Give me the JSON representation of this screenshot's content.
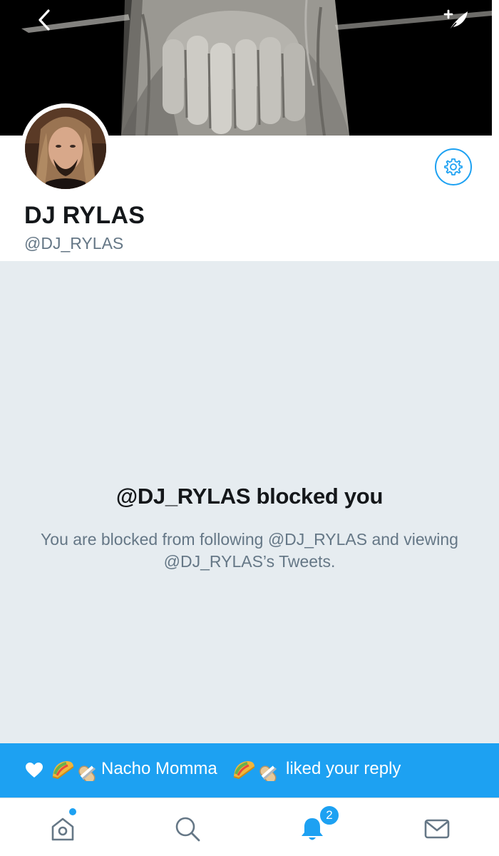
{
  "profile": {
    "display_name": "DJ RYLAS",
    "handle": "@DJ_RYLAS"
  },
  "blocked": {
    "title": "@DJ_RYLAS blocked you",
    "description": "You are blocked from following @DJ_RYLAS and viewing @DJ_RYLAS’s Tweets."
  },
  "toast": {
    "user_name": "Nacho Momma",
    "action_text": "liked your reply",
    "icon": "heart-icon",
    "emojis": [
      "taco",
      "burrito"
    ]
  },
  "tabbar": {
    "items": [
      {
        "icon": "home-icon",
        "has_dot": true
      },
      {
        "icon": "search-icon"
      },
      {
        "icon": "notifications-bell-icon",
        "active": true,
        "badge": "2"
      },
      {
        "icon": "messages-envelope-icon"
      }
    ]
  },
  "colors": {
    "accent": "#1da1f2",
    "blocked_bg": "#e6ecf0",
    "secondary_text": "#657786",
    "primary_text": "#14171a"
  }
}
